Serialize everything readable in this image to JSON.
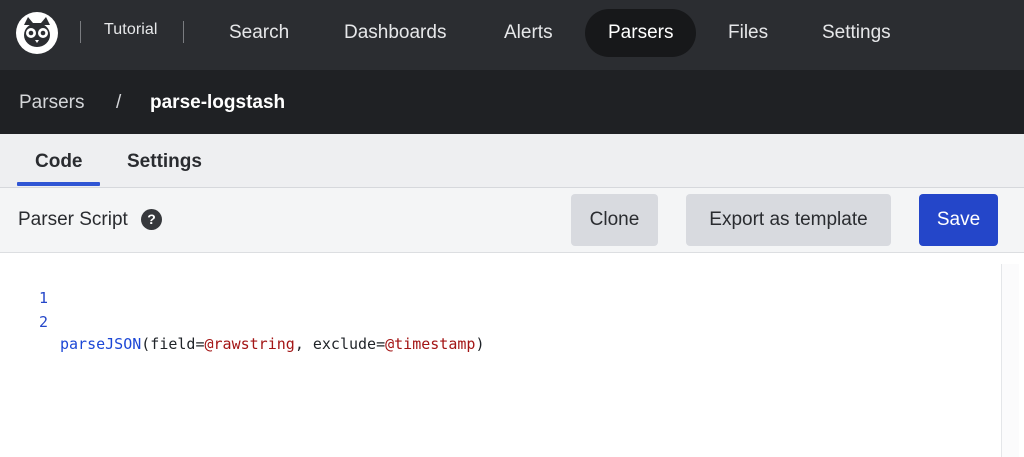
{
  "nav": {
    "repo": "Tutorial",
    "items": [
      "Search",
      "Dashboards",
      "Alerts",
      "Parsers",
      "Files",
      "Settings"
    ],
    "active": "Parsers"
  },
  "breadcrumb": {
    "root": "Parsers",
    "separator": "/",
    "current": "parse-logstash"
  },
  "tabs": [
    "Code",
    "Settings"
  ],
  "active_tab": "Code",
  "toolbar": {
    "title": "Parser Script",
    "help": "?",
    "clone_label": "Clone",
    "export_label": "Export as template",
    "save_label": "Save"
  },
  "editor": {
    "lines": [
      {
        "number": "1",
        "text": ""
      },
      {
        "number": "2",
        "fn": "parseJSON",
        "p1": "(field=",
        "v1": "@rawstring",
        "p2": ", exclude=",
        "v2": "@timestamp",
        "p3": ")"
      }
    ]
  },
  "colors": {
    "nav_bg": "#2b2d31",
    "breadcrumb_bg": "#1f2124",
    "accent": "#2446c9",
    "field_token": "#a31515"
  }
}
